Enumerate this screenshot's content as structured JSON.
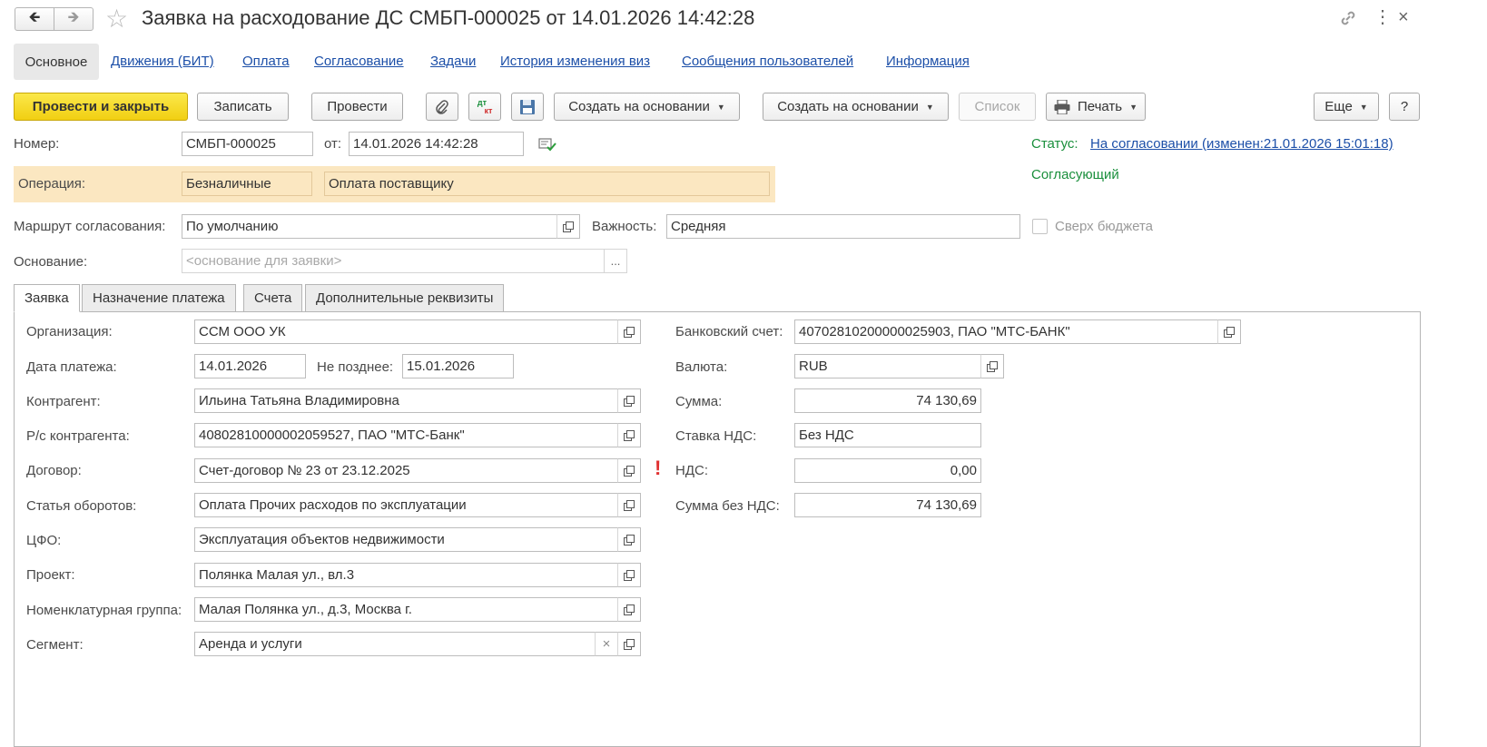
{
  "window": {
    "title": "Заявка на расходование ДС СМБП-000025 от 14.01.2026 14:42:28"
  },
  "nav_tabs": [
    {
      "label": "Основное"
    },
    {
      "label": "Движения (БИТ)"
    },
    {
      "label": "Оплата"
    },
    {
      "label": "Согласование"
    },
    {
      "label": "Задачи"
    },
    {
      "label": "История изменения виз"
    },
    {
      "label": "Сообщения пользователей"
    },
    {
      "label": "Информация"
    }
  ],
  "toolbar": {
    "post_close": "Провести и закрыть",
    "save": "Записать",
    "post": "Провести",
    "dt_label": "дт",
    "kt_label": "кт",
    "create_based_1": "Создать на основании",
    "create_based_2": "Создать на основании",
    "list": "Список",
    "print": "Печать",
    "more": "Еще",
    "help": "?"
  },
  "header": {
    "number_label": "Номер:",
    "number": "СМБП-000025",
    "from_label": "от:",
    "date": "14.01.2026 14:42:28",
    "status_label": "Статус:",
    "status_value": "На согласовании (изменен:21.01.2026 15:01:18)",
    "approver_label": "Согласующий",
    "operation_label": "Операция:",
    "operation_type": "Безналичные",
    "operation_value": "Оплата поставщику",
    "route_label": "Маршрут согласования:",
    "route_value": "По умолчанию",
    "importance_label": "Важность:",
    "importance_value": "Средняя",
    "over_budget_label": "Сверх бюджета",
    "basis_label": "Основание:",
    "basis_placeholder": "<основание для заявки>",
    "basis_more": "..."
  },
  "content_tabs": [
    {
      "label": "Заявка"
    },
    {
      "label": "Назначение платежа"
    },
    {
      "label": "Счета"
    },
    {
      "label": "Дополнительные реквизиты"
    }
  ],
  "form_left": {
    "org_label": "Организация:",
    "org_value": "ССМ ООО УК",
    "pay_date_label": "Дата платежа:",
    "pay_date": "14.01.2026",
    "not_later_label": "Не позднее:",
    "not_later": "15.01.2026",
    "counterparty_label": "Контрагент:",
    "counterparty_value": "Ильина Татьяна Владимировна",
    "account_label": "Р/с контрагента:",
    "account_value": "40802810000002059527, ПАО \"МТС-Банк\"",
    "contract_label": "Договор:",
    "contract_value": "Счет-договор № 23 от 23.12.2025",
    "item_label": "Статья оборотов:",
    "item_value": "Оплата Прочих расходов по эксплуатации",
    "cfo_label": "ЦФО:",
    "cfo_value": "Эксплуатация объектов недвижимости",
    "project_label": "Проект:",
    "project_value": "Полянка Малая ул., вл.3",
    "nomgroup_label": "Номенклатурная группа:",
    "nomgroup_value": "Малая Полянка ул., д.3, Москва г.",
    "segment_label": "Сегмент:",
    "segment_value": "Аренда и услуги"
  },
  "form_right": {
    "bank_label": "Банковский счет:",
    "bank_value": "40702810200000025903, ПАО \"МТС-БАНК\"",
    "currency_label": "Валюта:",
    "currency_value": "RUB",
    "sum_label": "Сумма:",
    "sum_value": "74 130,69",
    "vat_rate_label": "Ставка НДС:",
    "vat_rate_value": "Без НДС",
    "vat_label": "НДС:",
    "vat_value": "0,00",
    "sum_wo_vat_label": "Сумма без НДС:",
    "sum_wo_vat_value": "74 130,69",
    "warning_mark": "!"
  },
  "colors": {
    "primary_button": "#f4d62a",
    "link": "#1c4fa8",
    "status_green": "#1a8f3c",
    "operation_bg": "#fbe7c1",
    "warning": "#e03030"
  }
}
